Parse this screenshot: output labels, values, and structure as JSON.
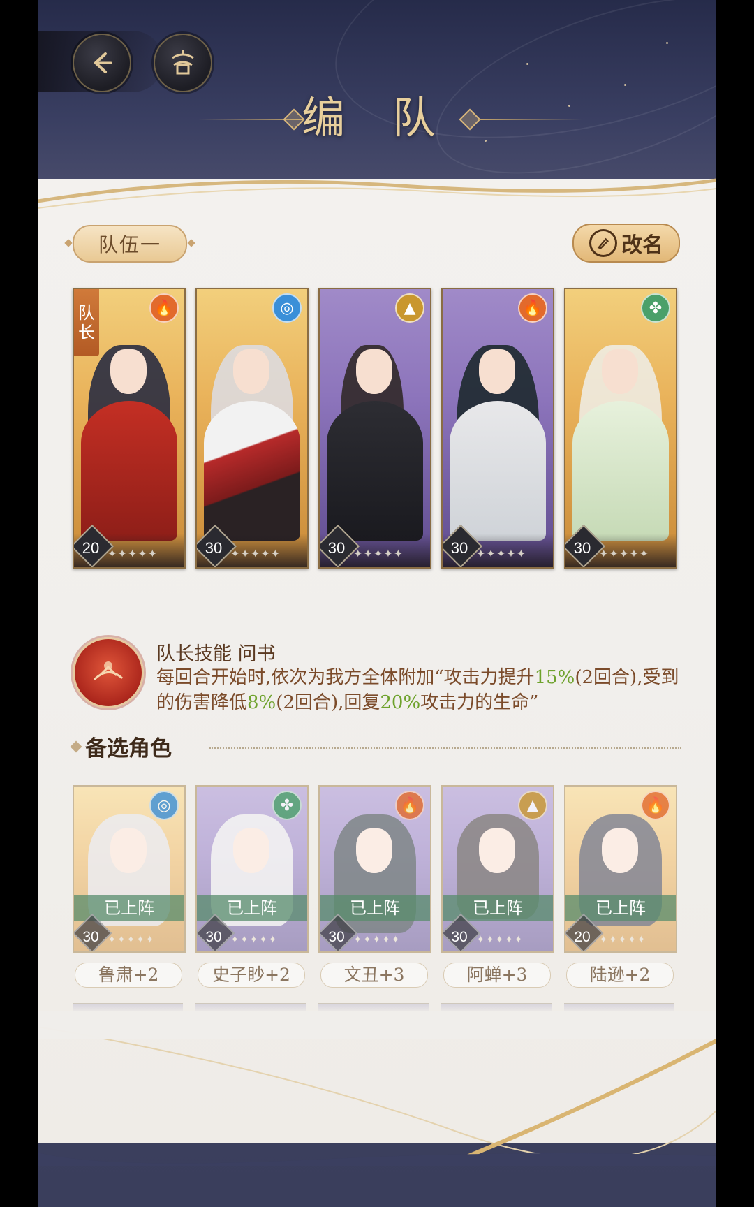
{
  "page": {
    "title": "编 队"
  },
  "top_buttons": {
    "back_icon": "back-arrow-icon",
    "home_icon": "pavilion-home-icon"
  },
  "team": {
    "tab_label": "队伍一",
    "rename_label": "改名",
    "captain_tag": [
      "队",
      "长"
    ],
    "members": [
      {
        "level": "20",
        "element": "fire",
        "card_bg": "gold",
        "captain": true
      },
      {
        "level": "30",
        "element": "water",
        "card_bg": "gold",
        "captain": false
      },
      {
        "level": "30",
        "element": "earth",
        "card_bg": "purple",
        "captain": false
      },
      {
        "level": "30",
        "element": "fire",
        "card_bg": "purple",
        "captain": false
      },
      {
        "level": "30",
        "element": "wind",
        "card_bg": "gold",
        "captain": false
      }
    ],
    "stars": "✦✦✦✦✦"
  },
  "skill": {
    "title": "队长技能  问书",
    "desc_parts": [
      "每回合开始时,依次为我方全体附加“攻击力提升",
      "15%",
      "(2回合),受到的伤害降低",
      "8%",
      "(2回合),回复",
      "20%",
      "攻击力的生命”"
    ],
    "highlight_color": "#6ea22c"
  },
  "reserve": {
    "title": "备选角色",
    "deployed_label": "已上阵",
    "cards": [
      {
        "level": "30",
        "element": "water",
        "card_bg": "gold",
        "name": "鲁肃+2"
      },
      {
        "level": "30",
        "element": "wind",
        "card_bg": "purple",
        "name": "史子眇+2"
      },
      {
        "level": "30",
        "element": "fire",
        "card_bg": "purple",
        "name": "文丑+3"
      },
      {
        "level": "30",
        "element": "earth",
        "card_bg": "purple",
        "name": "阿蝉+3"
      },
      {
        "level": "20",
        "element": "fire",
        "card_bg": "gold",
        "name": "陆逊+2"
      }
    ]
  }
}
